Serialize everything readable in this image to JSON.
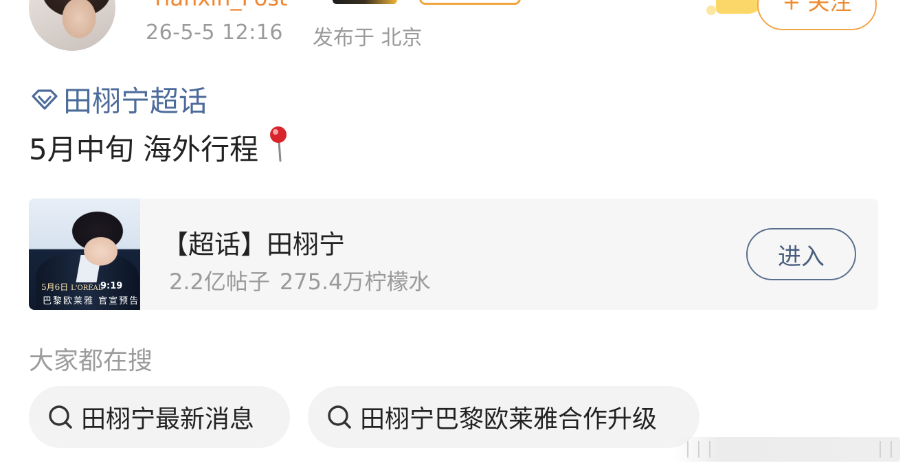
{
  "header": {
    "username": "Tianxin_Post",
    "time": "26-5-5 12:16",
    "location": "发布于 北京",
    "follow_label": "+ 关注"
  },
  "post": {
    "topic_tag": "田栩宁超话",
    "text": "5月中旬 海外行程",
    "pin_icon": "round-pushpin-icon"
  },
  "card": {
    "title": "【超话】田栩宁",
    "posts_count": "2.2亿帖子",
    "fans_count": "275.4万柠檬水",
    "enter_label": "进入",
    "thumb_date": "5月6日",
    "thumb_brand": "L'ORÉAL",
    "thumb_time": "9:19",
    "thumb_caption": "巴黎欧莱雅 官宣预告"
  },
  "search": {
    "heading": "大家都在搜",
    "chips": [
      {
        "label": "田栩宁最新消息"
      },
      {
        "label": "田栩宁巴黎欧莱雅合作升级"
      }
    ]
  },
  "colors": {
    "accent_orange": "#f08a30",
    "topic_blue": "#4c6b9a",
    "muted_gray": "#9a9a9a",
    "card_bg": "#f6f6f6"
  }
}
